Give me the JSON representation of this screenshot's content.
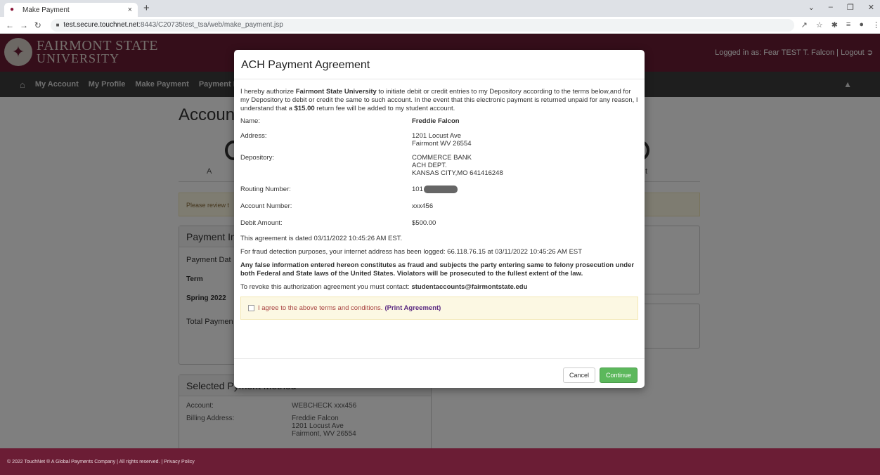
{
  "browser": {
    "tab_title": "Make Payment",
    "tab_close": "×",
    "new_tab": "+",
    "url_host": "test.secure.touchnet.net",
    "url_path": ":8443/C20735test_tsa/web/make_payment.jsp"
  },
  "header": {
    "logo_line1": "FAIRMONT STATE",
    "logo_line2": "UNIVERSITY",
    "logged_in": "Logged in as: Fear TEST T. Falcon",
    "logout": "Logout"
  },
  "nav": {
    "items": [
      "My Account",
      "My Profile",
      "Make Payment",
      "Payment Plans"
    ]
  },
  "page": {
    "title": "Accoun",
    "step_label_left": "A",
    "step_label_right": "t",
    "review_text": "Please review t",
    "payment_info_title": "Payment In",
    "payment_date": "Payment Dat",
    "term_header": "Term",
    "term_value": "Spring 2022",
    "total_payment": "Total Paymen",
    "selected_title": "Selected P",
    "selected_title_tail": "yment Method",
    "account_label": "Account:",
    "account_value": "WEBCHECK xxx456",
    "billing_label": "Billing Address:",
    "billing_lines": [
      "Freddie Falcon",
      "1201 Locust Ave",
      "Fairmont, WV 26554"
    ]
  },
  "modal": {
    "title": "ACH Payment Agreement",
    "intro_1": "I hereby authorize ",
    "intro_org": "Fairmont State University",
    "intro_2": " to initiate debit or credit entries to my Depository according to the terms below,and for my Depository to debit or credit the same to such account. In the event that this electronic payment is returned unpaid for any reason, I understand that a ",
    "intro_fee": "$15.00",
    "intro_3": " return fee will be added to my student account.",
    "name_label": "Name:",
    "name_value": "Freddie Falcon",
    "address_label": "Address:",
    "address_lines": [
      "1201 Locust Ave",
      "Fairmont WV 26554"
    ],
    "depository_label": "Depository:",
    "depository_lines": [
      "COMMERCE BANK",
      "ACH DEPT.",
      "KANSAS CITY,MO 641416248"
    ],
    "routing_label": "Routing Number:",
    "routing_value": "101",
    "account_label": "Account Number:",
    "account_value": "xxx456",
    "debit_label": "Debit Amount:",
    "debit_value": "$500.00",
    "dated": "This agreement is dated 03/11/2022 10:45:26 AM EST.",
    "fraud": "For fraud detection purposes, your internet address has been logged: 66.118.76.15 at 03/11/2022 10:45:26 AM EST",
    "warning": "Any false information entered hereon constitutes as fraud and subjects the party entering same to felony prosecution under both Federal and State laws of the United States. Violators will be prosecuted to the fullest extent of the law.",
    "revoke_text": "To revoke this authorization agreement you must contact: ",
    "revoke_email": "studentaccounts@fairmontstate.edu",
    "agree_text": "I agree to the above terms and conditions.",
    "print_link": "(Print Agreement)",
    "cancel": "Cancel",
    "continue": "Continue"
  },
  "footer": {
    "text": "© 2022 TouchNet ® A Global Payments Company | All rights reserved. | Privacy Policy"
  },
  "colors": {
    "brand_maroon": "#6b1d35",
    "nav_dark": "#3d3d3d",
    "continue_green": "#5cb85c",
    "warning_bg": "#fcf8e3"
  }
}
